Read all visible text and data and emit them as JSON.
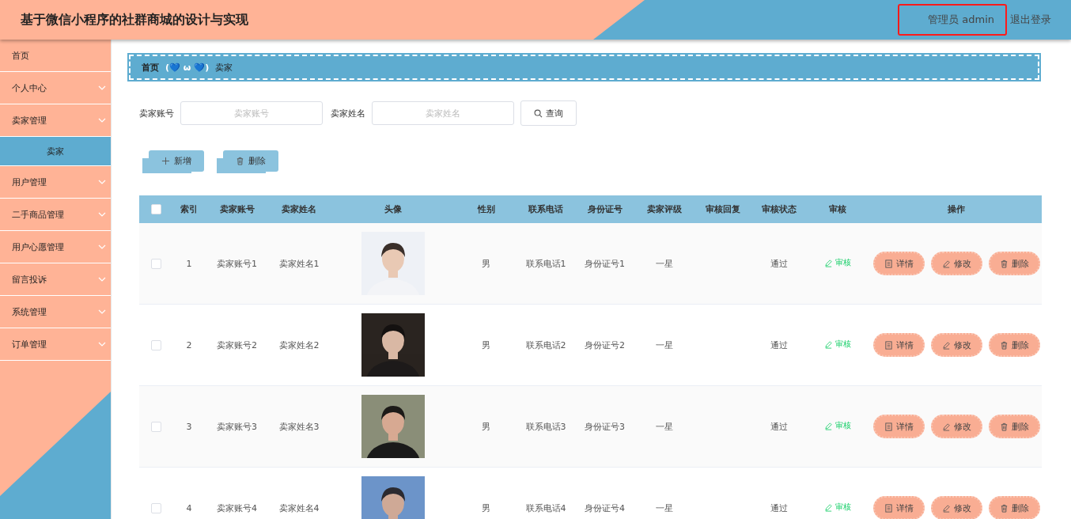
{
  "header": {
    "title": "基于微信小程序的社群商城的设计与实现",
    "user": "管理员 admin",
    "logout": "退出登录"
  },
  "sidebar": {
    "items": [
      {
        "label": "首页",
        "has_children": false
      },
      {
        "label": "个人中心",
        "has_children": true,
        "expanded": false
      },
      {
        "label": "卖家管理",
        "has_children": true,
        "expanded": true,
        "children": [
          {
            "label": "卖家",
            "selected": true
          }
        ]
      },
      {
        "label": "用户管理",
        "has_children": true,
        "expanded": false
      },
      {
        "label": "二手商品管理",
        "has_children": true,
        "expanded": false
      },
      {
        "label": "用户心愿管理",
        "has_children": true,
        "expanded": false
      },
      {
        "label": "留言投诉",
        "has_children": true,
        "expanded": false
      },
      {
        "label": "系统管理",
        "has_children": true,
        "expanded": false
      },
      {
        "label": "订单管理",
        "has_children": true,
        "expanded": false
      }
    ]
  },
  "breadcrumb": {
    "home": "首页",
    "separator": "(💙 ω 💙)",
    "current": "卖家"
  },
  "search": {
    "fields": [
      {
        "label": "卖家账号",
        "placeholder": "卖家账号"
      },
      {
        "label": "卖家姓名",
        "placeholder": "卖家姓名"
      }
    ],
    "button": "查询"
  },
  "toolbar": [
    {
      "kind": "add",
      "label": "新增"
    },
    {
      "kind": "delete",
      "label": "删除"
    }
  ],
  "table": {
    "header_checked": false,
    "columns": [
      "索引",
      "卖家账号",
      "卖家姓名",
      "头像",
      "性别",
      "联系电话",
      "身份证号",
      "卖家评级",
      "审核回复",
      "审核状态",
      "审核",
      "操作"
    ],
    "rows": [
      {
        "checked": false,
        "index": "1",
        "account": "卖家账号1",
        "name": "卖家姓名1",
        "gender": "男",
        "phone": "联系电话1",
        "id_number": "身份证号1",
        "rating": "一星",
        "status": "通过",
        "review": "审核",
        "actions": [
          {
            "kind": "detail",
            "label": "详情"
          },
          {
            "kind": "edit",
            "label": "修改"
          },
          {
            "kind": "delete",
            "label": "删除"
          }
        ]
      },
      {
        "checked": false,
        "index": "2",
        "account": "卖家账号2",
        "name": "卖家姓名2",
        "gender": "男",
        "phone": "联系电话2",
        "id_number": "身份证号2",
        "rating": "一星",
        "status": "通过",
        "review": "审核",
        "actions": [
          {
            "kind": "detail",
            "label": "详情"
          },
          {
            "kind": "edit",
            "label": "修改"
          },
          {
            "kind": "delete",
            "label": "删除"
          }
        ]
      },
      {
        "checked": false,
        "index": "3",
        "account": "卖家账号3",
        "name": "卖家姓名3",
        "gender": "男",
        "phone": "联系电话3",
        "id_number": "身份证号3",
        "rating": "一星",
        "status": "通过",
        "review": "审核",
        "actions": [
          {
            "kind": "detail",
            "label": "详情"
          },
          {
            "kind": "edit",
            "label": "修改"
          },
          {
            "kind": "delete",
            "label": "删除"
          }
        ]
      },
      {
        "checked": false,
        "index": "4",
        "account": "卖家账号4",
        "name": "卖家姓名4",
        "gender": "男",
        "phone": "联系电话4",
        "id_number": "身份证号4",
        "rating": "一星",
        "status": "通过",
        "review": "审核",
        "actions": [
          {
            "kind": "detail",
            "label": "详情"
          },
          {
            "kind": "edit",
            "label": "修改"
          },
          {
            "kind": "delete",
            "label": "删除"
          }
        ]
      }
    ]
  }
}
